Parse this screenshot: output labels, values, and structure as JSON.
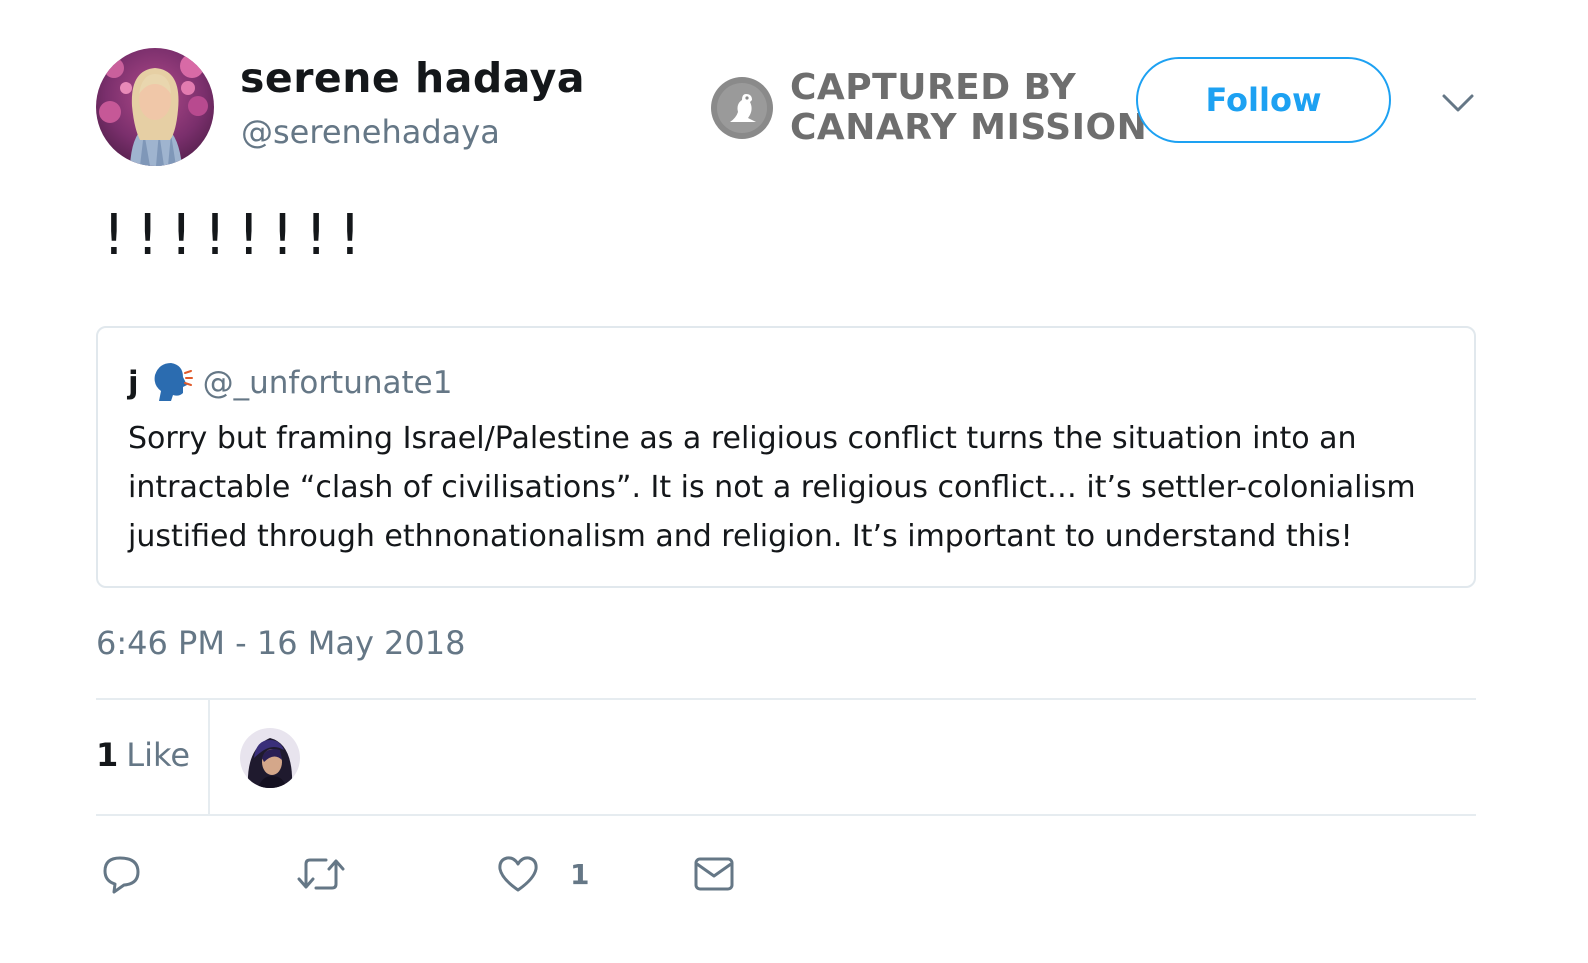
{
  "author": {
    "display_name": "serene hadaya",
    "handle": "@serenehadaya"
  },
  "watermark": {
    "line1": "CAPTURED BY",
    "line2": "CANARY MISSION"
  },
  "follow_button": {
    "label": "Follow"
  },
  "tweet": {
    "text": "!!!!!!!!"
  },
  "quoted_tweet": {
    "display_name": "j",
    "handle": "@_unfortunate1",
    "text": "Sorry but framing Israel/Palestine as a religious conflict turns the situation into an intractable “clash of civilisations”. It is not a religious conflict… it’s settler-colonialism justified through ethnonationalism and religion. It’s important to understand this!"
  },
  "timestamp": "6:46 PM - 16 May 2018",
  "stats": {
    "likes_count": "1",
    "likes_label": "Like"
  },
  "actions": {
    "like_count": "1"
  },
  "colors": {
    "accent": "#1da1f2",
    "secondary_text": "#657786",
    "border": "#e1e8ed",
    "watermark": "#6e6e6e"
  },
  "icons": [
    "reply-icon",
    "retweet-icon",
    "like-icon",
    "direct-message-icon",
    "chevron-down-icon",
    "canary-logo-icon",
    "speaking-head-emoji"
  ]
}
